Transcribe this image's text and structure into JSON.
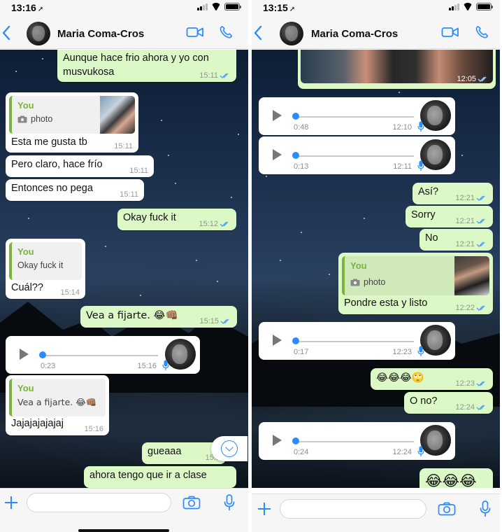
{
  "left": {
    "status_time": "13:16",
    "contact_name": "Maria Coma-Cros",
    "messages": [
      {
        "text": "Aunque hace frio ahora y yo con",
        "text2": "musvukosa",
        "time": "15:11"
      },
      {
        "quote_name": "You",
        "quote_text": "photo",
        "text": "Esta me gusta tb",
        "time": "15:11"
      },
      {
        "text": "Pero claro, hace frío",
        "time": "15:11"
      },
      {
        "text": "Entonces no pega",
        "time": "15:11"
      },
      {
        "text": "Okay fuck it",
        "time": "15:12"
      },
      {
        "quote_name": "You",
        "quote_text": "Okay fuck it",
        "text": "Cuál??",
        "time": "15:14"
      },
      {
        "text": "Vea a fijarte. 😂👊🏽",
        "time": "15:15"
      },
      {
        "duration": "0:23",
        "time": "15:16"
      },
      {
        "quote_name": "You",
        "quote_text": "Vea a fijarte. 😂👊🏽",
        "text": "Jajajajajajaj",
        "time": "15:16"
      },
      {
        "text": "gueaaa",
        "time": "15:1"
      },
      {
        "text": "ahora tengo que ir a clase",
        "time": ""
      }
    ]
  },
  "right": {
    "status_time": "13:15",
    "contact_name": "Maria Coma-Cros",
    "messages": [
      {
        "time": "12:05"
      },
      {
        "duration": "0:48",
        "time": "12:10"
      },
      {
        "duration": "0:13",
        "time": "12:11"
      },
      {
        "text": "Así?",
        "time": "12:21"
      },
      {
        "text": "Sorry",
        "time": "12:21"
      },
      {
        "text": "No",
        "time": "12:21"
      },
      {
        "quote_name": "You",
        "quote_text": "photo",
        "text": "Pondre esta y listo",
        "time": "12:22"
      },
      {
        "duration": "0:17",
        "time": "12:23"
      },
      {
        "text": "😂😂😂🙄",
        "time": "12:23"
      },
      {
        "text": "O no?",
        "time": "12:24"
      },
      {
        "duration": "0:24",
        "time": "12:24"
      },
      {
        "text": "😂😂😂",
        "time": ""
      }
    ]
  },
  "colors": {
    "accent_blue": "#2b8cff",
    "outgoing_bubble": "#dcf8c6",
    "incoming_bubble": "#ffffff",
    "quote_green": "#7bb33c",
    "read_ticks": "#4fa3f7"
  },
  "icons": [
    "back-chevron-icon",
    "video-call-icon",
    "phone-icon",
    "plus-icon",
    "camera-icon",
    "microphone-icon",
    "play-icon",
    "double-check-icon",
    "chevron-down-icon"
  ]
}
